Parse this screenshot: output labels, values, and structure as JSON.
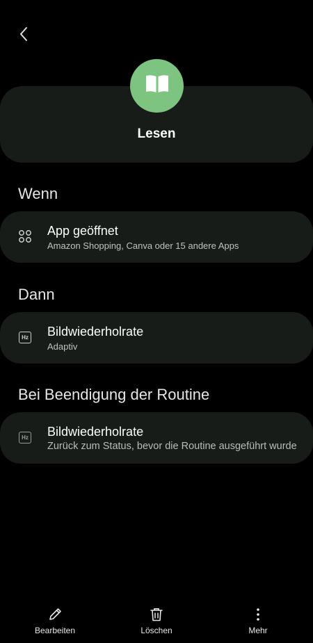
{
  "header": {
    "back_icon": "chevron-left-icon",
    "routine_icon": "book-open-icon",
    "routine_icon_color": "#7cc47f",
    "routine_name": "Lesen"
  },
  "sections": {
    "when": {
      "title": "Wenn",
      "item": {
        "icon": "apps-grid-icon",
        "title": "App geöffnet",
        "subtitle": "Amazon Shopping, Canva oder 15 andere Apps"
      }
    },
    "then": {
      "title": "Dann",
      "item": {
        "icon": "refresh-rate-icon",
        "icon_text": "Hz",
        "title": "Bildwiederholrate",
        "subtitle": "Adaptiv"
      }
    },
    "on_end": {
      "title": "Bei Beendigung der Routine",
      "item": {
        "icon": "refresh-rate-icon",
        "icon_text": "Hz",
        "title": "Bildwiederholrate",
        "subtitle": "Zurück zum Status, bevor die Routine ausgeführt wurde"
      }
    }
  },
  "bottom_bar": {
    "edit_label": "Bearbeiten",
    "delete_label": "Löschen",
    "more_label": "Mehr"
  },
  "colors": {
    "background": "#000000",
    "card": "#171c19",
    "accent": "#7cc47f"
  }
}
